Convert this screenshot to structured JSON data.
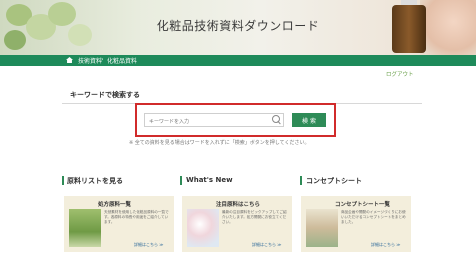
{
  "hero": {
    "title": "化粧品技術資料ダウンロード"
  },
  "breadcrumb": {
    "items": [
      "技術資料",
      "化粧品資料"
    ]
  },
  "header": {
    "logout": "ログアウト"
  },
  "keyword_search": {
    "title": "キーワードで検索する",
    "placeholder": "キーワードを入力",
    "button": "検 索",
    "note": "※ 全ての資料を見る場合はワードを入れずに「検索」ボタンを押してください。"
  },
  "sections": [
    {
      "title": "原料リストを見る",
      "card_title": "処方原料一覧",
      "card_text": "天然素材を使用した化粧品原料の一覧です。各原料の特長や用途をご紹介しています。",
      "more": "詳細はこちら ≫"
    },
    {
      "title": "What's New",
      "card_title": "注目原料はこちら",
      "card_text": "最新の注目原料をピックアップしてご紹介いたします。処方開発にお役立てください。",
      "more": "詳細はこちら ≫"
    },
    {
      "title": "コンセプトシート",
      "card_title": "コンセプトシート一覧",
      "card_text": "商品企画や開発のイメージづくりにお使いいただけるコンセプトシートをまとめました。",
      "more": "詳細はこちら ≫"
    }
  ],
  "colors": {
    "accent": "#2e8b57",
    "highlight": "#d12b2b",
    "card_bg": "#f3eedc"
  }
}
